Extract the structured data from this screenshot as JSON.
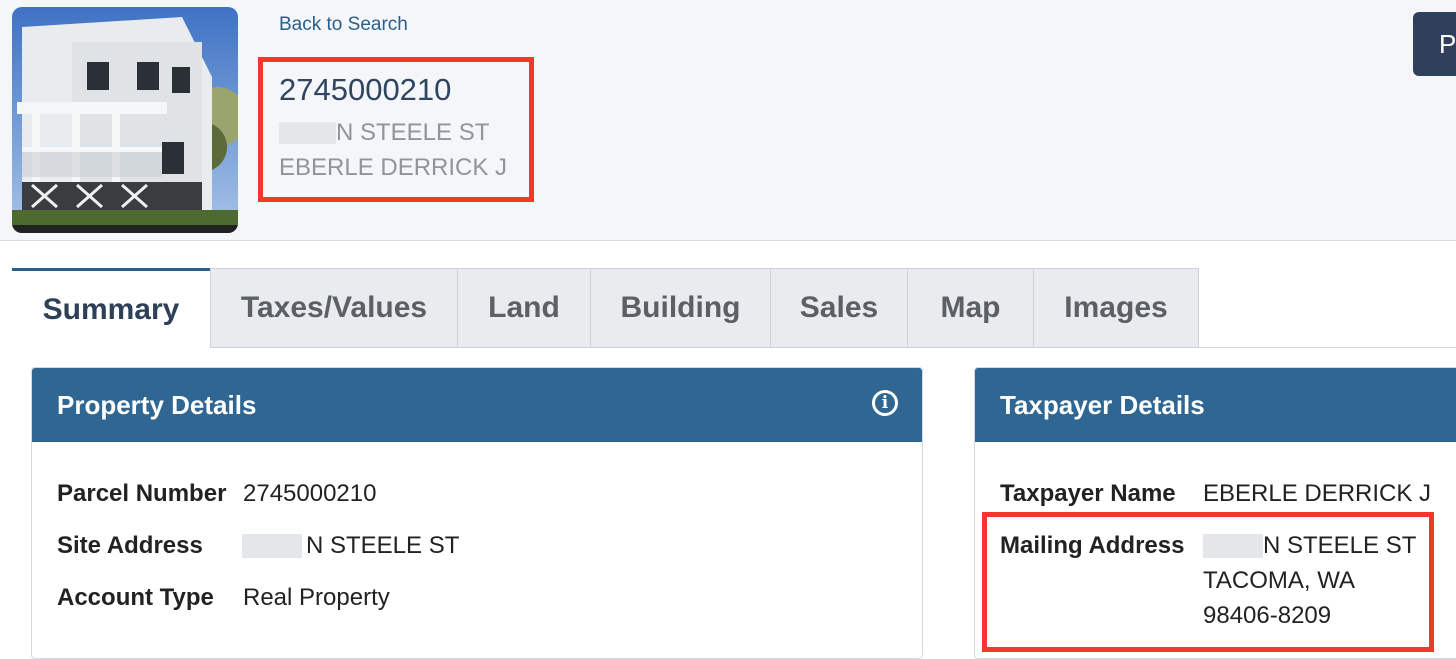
{
  "header": {
    "back_link": "Back to Search",
    "parcel_number": "2745000210",
    "site_address": "N STEELE ST",
    "owner": "EBERLE DERRICK J",
    "print_button": "P"
  },
  "tabs": [
    "Summary",
    "Taxes/Values",
    "Land",
    "Building",
    "Sales",
    "Map",
    "Images"
  ],
  "active_tab": "Summary",
  "property_details": {
    "title": "Property Details",
    "rows": [
      {
        "label": "Parcel Number",
        "value": "2745000210"
      },
      {
        "label": "Site Address",
        "value": "N STEELE ST"
      },
      {
        "label": "Account Type",
        "value": "Real Property"
      }
    ]
  },
  "taxpayer_details": {
    "title": "Taxpayer Details",
    "name_label": "Taxpayer Name",
    "name_value": "EBERLE DERRICK J",
    "mailing_label": "Mailing Address",
    "mailing_line1": "N STEELE ST",
    "mailing_line2": "TACOMA, WA",
    "mailing_line3": "98406-8209"
  },
  "colors": {
    "panel_header": "#2f6792",
    "highlight_box": "#f2382c",
    "print_button": "#2f3f5c"
  },
  "icons": [
    "house-photo",
    "info-icon"
  ]
}
